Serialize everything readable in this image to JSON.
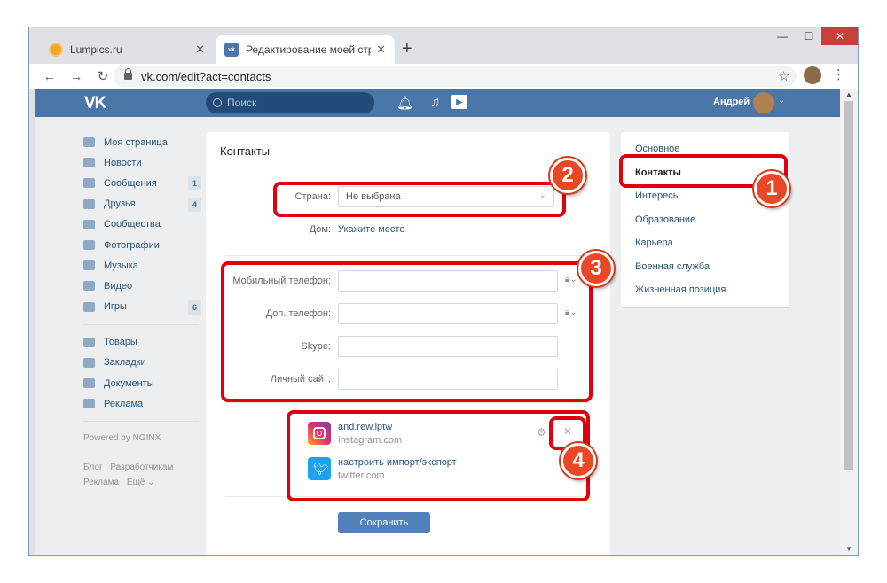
{
  "browser": {
    "tabs": [
      {
        "title": "Lumpics.ru",
        "active": false
      },
      {
        "title": "Редактирование моей страниц",
        "active": true
      }
    ],
    "new_tab": "+",
    "close_glyph": "✕",
    "nav": {
      "back": "←",
      "forward": "→",
      "reload": "↻"
    },
    "url": "vk.com/edit?act=contacts",
    "window_controls": {
      "minimize": "—",
      "maximize": "☐",
      "close": "✕"
    }
  },
  "vk_header": {
    "logo": "VK",
    "search_placeholder": "Поиск",
    "user_name": "Андрей"
  },
  "left_menu": {
    "items": [
      {
        "label": "Моя страница",
        "icon": "home-icon"
      },
      {
        "label": "Новости",
        "icon": "news-icon"
      },
      {
        "label": "Сообщения",
        "icon": "messages-icon",
        "badge": "1"
      },
      {
        "label": "Друзья",
        "icon": "friends-icon",
        "badge": "4"
      },
      {
        "label": "Сообщества",
        "icon": "groups-icon"
      },
      {
        "label": "Фотографии",
        "icon": "photos-icon"
      },
      {
        "label": "Музыка",
        "icon": "music-icon"
      },
      {
        "label": "Видео",
        "icon": "video-icon"
      },
      {
        "label": "Игры",
        "icon": "games-icon",
        "badge": "6"
      }
    ],
    "items2": [
      {
        "label": "Товары",
        "icon": "market-icon"
      },
      {
        "label": "Закладки",
        "icon": "bookmarks-icon"
      },
      {
        "label": "Документы",
        "icon": "documents-icon"
      },
      {
        "label": "Реклама",
        "icon": "ads-icon"
      }
    ],
    "powered": "Powered by NGINX",
    "footer": [
      "Блог",
      "Разработчикам",
      "Реклама",
      "Ещё ⌄"
    ]
  },
  "contacts": {
    "title": "Контакты",
    "country_label": "Страна:",
    "country_value": "Не выбрана",
    "home_label": "Дом:",
    "home_link": "Укажите место",
    "mobile_label": "Мобильный телефон:",
    "extra_phone_label": "Доп. телефон:",
    "skype_label": "Skype:",
    "site_label": "Личный сайт:",
    "services": [
      {
        "name": "and.rew.lptw",
        "sub": "instagram.com",
        "icon": "instagram-icon"
      },
      {
        "name": "настроить импорт/экспорт",
        "sub": "twitter.com",
        "icon": "twitter-icon"
      }
    ],
    "save_label": "Сохранить"
  },
  "right_menu": {
    "items": [
      "Основное",
      "Контакты",
      "Интересы",
      "Образование",
      "Карьера",
      "Военная служба",
      "Жизненная позиция"
    ],
    "active_index": 1
  },
  "annotations": [
    "1",
    "2",
    "3",
    "4"
  ],
  "colors": {
    "vk_blue": "#4a76a8",
    "annotation_red": "#e0000f",
    "badge_orange": "#ea4727"
  }
}
